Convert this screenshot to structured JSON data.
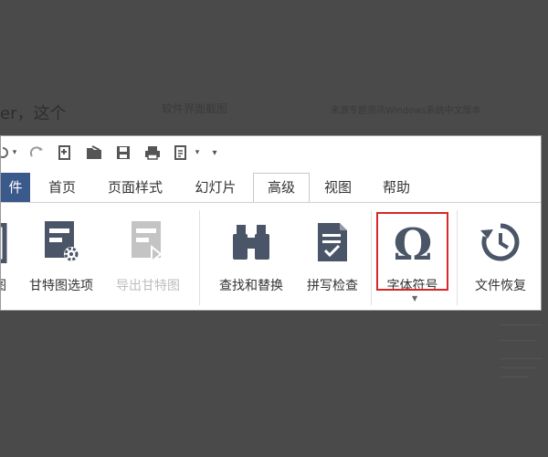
{
  "background": {
    "left_text": "er，这个",
    "mid_text": "软件界面截图",
    "right_text": "来源专题资讯Windows系统中文版本"
  },
  "quick_access": {
    "icons": [
      "redo-icon",
      "new-icon",
      "open-icon",
      "save-icon",
      "print-icon",
      "preview-icon",
      "customize-icon"
    ]
  },
  "tabs": [
    {
      "label": "件",
      "name": "tab-file"
    },
    {
      "label": "首页",
      "name": "tab-home"
    },
    {
      "label": "页面样式",
      "name": "tab-page-style"
    },
    {
      "label": "幻灯片",
      "name": "tab-slides"
    },
    {
      "label": "高级",
      "name": "tab-advanced",
      "active": true
    },
    {
      "label": "视图",
      "name": "tab-view"
    },
    {
      "label": "帮助",
      "name": "tab-help"
    }
  ],
  "ribbon": {
    "buttons": [
      {
        "label": "图",
        "name": "partial-left-button"
      },
      {
        "label": "甘特图选项",
        "name": "gantt-options-button"
      },
      {
        "label": "导出甘特图",
        "name": "export-gantt-button",
        "disabled": true
      },
      {
        "label": "查找和替换",
        "name": "find-replace-button"
      },
      {
        "label": "拼写检查",
        "name": "spell-check-button"
      },
      {
        "label": "字体符号",
        "name": "font-symbol-button",
        "highlighted": true
      },
      {
        "label": "文件恢复",
        "name": "file-recovery-button"
      }
    ]
  },
  "colors": {
    "accent": "#3a5a8c",
    "highlight": "#d62828",
    "icon": "#4a5668"
  }
}
